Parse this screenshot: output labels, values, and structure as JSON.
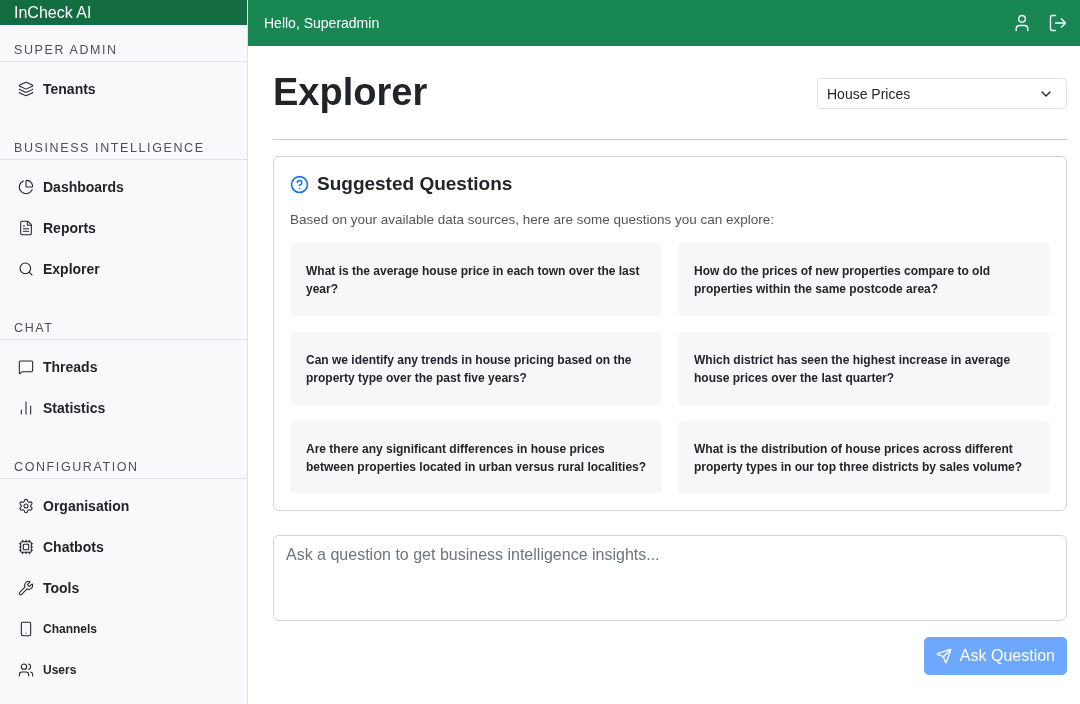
{
  "brand": "InCheck AI",
  "greeting": "Hello, Superadmin",
  "sidebar": {
    "sections": [
      {
        "title": "SUPER ADMIN",
        "items": [
          {
            "label": "Tenants",
            "kind": "normal"
          }
        ]
      },
      {
        "title": "BUSINESS INTELLIGENCE",
        "items": [
          {
            "label": "Dashboards",
            "kind": "normal"
          },
          {
            "label": "Reports",
            "kind": "normal"
          },
          {
            "label": "Explorer",
            "kind": "normal"
          }
        ]
      },
      {
        "title": "CHAT",
        "items": [
          {
            "label": "Threads",
            "kind": "normal"
          },
          {
            "label": "Statistics",
            "kind": "normal"
          }
        ]
      },
      {
        "title": "CONFIGURATION",
        "items": [
          {
            "label": "Organisation",
            "kind": "normal"
          },
          {
            "label": "Chatbots",
            "kind": "normal"
          },
          {
            "label": "Tools",
            "kind": "normal"
          },
          {
            "label": "Channels",
            "kind": "small"
          },
          {
            "label": "Users",
            "kind": "small"
          }
        ]
      }
    ]
  },
  "page": {
    "title": "Explorer",
    "data_source": "House Prices"
  },
  "suggestions": {
    "title": "Suggested Questions",
    "intro": "Based on your available data sources, here are some questions you can explore:",
    "questions": [
      "What is the average house price in each town over the last year?",
      "How do the prices of new properties compare to old properties within the same postcode area?",
      "Can we identify any trends in house pricing based on the property type over the past five years?",
      "Which district has seen the highest increase in average house prices over the last quarter?",
      "Are there any significant differences in house prices between properties located in urban versus rural localities?",
      "What is the distribution of house prices across different property types in our top three districts by sales volume?"
    ]
  },
  "question_input": {
    "placeholder": "Ask a question to get business intelligence insights..."
  },
  "ask_button": {
    "label": "Ask Question",
    "disabled": true
  }
}
